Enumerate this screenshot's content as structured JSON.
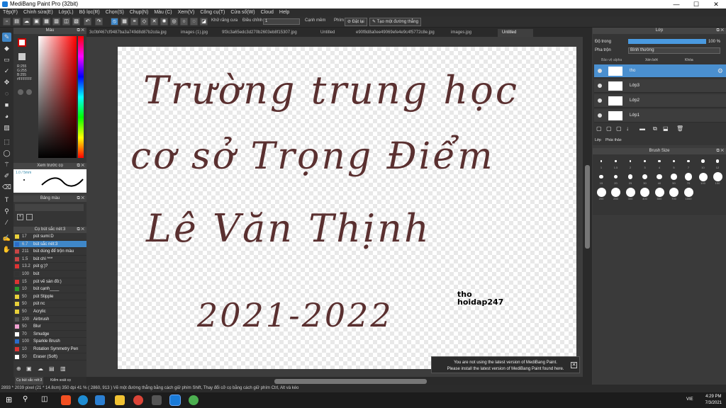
{
  "window": {
    "title": "MediBang Paint Pro (32bit)",
    "min": "—",
    "max": "☐",
    "close": "✕"
  },
  "menu": [
    "Tệp(F)",
    "Chỉnh sửa(E)",
    "Lớp(L)",
    "Bộ lọc(R)",
    "Chọn(S)",
    "Chụp(N)",
    "Màu (C)",
    "Xem(V)",
    "Công cụ(T)",
    "Cửa sổ(W)",
    "Cloud",
    "Help"
  ],
  "toolbar": {
    "antialias_label": "Khử răng cưa",
    "correction_label": "Điều chỉnh",
    "correction_value": "1",
    "canh_mem": "Cạnh mềm",
    "phim": "Phím",
    "dat_lai": "Đặt lại",
    "tao_duong": "Tạo một đường thẳng"
  },
  "color_panel": {
    "title": "Màu",
    "rgb": [
      "R:255",
      "G:255",
      "B:255"
    ],
    "hex": "#FFFFFF"
  },
  "nav_panel": {
    "title": "Xem trước cọ",
    "size": "1.0 / 5mm"
  },
  "color_set_panel": {
    "title": "Bảng màu"
  },
  "brush_panel": {
    "title": "Cọ bút sắc nét:3",
    "footer_tab1": "Cọ bút sắc nét:3",
    "footer_tab2": "Kiểm soát cọ",
    "brushes": [
      {
        "size": "17",
        "name": "pút sumi:D",
        "color": "#e8d03a"
      },
      {
        "size": "6.7",
        "name": "bút sắc nét:3",
        "color": "#2a6cc9",
        "selected": true
      },
      {
        "size": "211",
        "name": "bút dùng để trộn màu",
        "color": "#c94545"
      },
      {
        "size": "1.5",
        "name": "bút chì *^*",
        "color": "#c94545"
      },
      {
        "size": "13.2",
        "name": "pút g:)?",
        "color": "#d33"
      },
      {
        "size": "100",
        "name": "bút",
        "color": "#333"
      },
      {
        "size": "15",
        "name": "pút vẽ sàn đồ:)",
        "color": "#d33"
      },
      {
        "size": "10",
        "name": "bút cạnh____",
        "color": "#2a9a2a"
      },
      {
        "size": "50",
        "name": "pút Stipple",
        "color": "#e8d03a"
      },
      {
        "size": "50",
        "name": "pút nc",
        "color": "#e8d03a"
      },
      {
        "size": "50",
        "name": "Acrylic",
        "color": "#e8d03a"
      },
      {
        "size": "100",
        "name": "Airbrush",
        "color": "#555"
      },
      {
        "size": "50",
        "name": "Blur",
        "color": "#f0a0d0"
      },
      {
        "size": "70",
        "name": "Smudge",
        "color": "#ffffff"
      },
      {
        "size": "100",
        "name": "Sparkle Brush",
        "color": "#2a6cc9"
      },
      {
        "size": "10",
        "name": "Rotation Symmetry Pen",
        "color": "#d33"
      },
      {
        "size": "50",
        "name": "Eraser (Soft)",
        "color": "#ffffff"
      }
    ]
  },
  "tabs": [
    "3c0bf467cf9487ba3a749d8d87b2cda.jpg",
    "images (1).jpg",
    "9f3c3a65edc3d270b2603eb8f15307.jpg",
    "Untitled",
    "e90f8d8a0ee49069efe4e9c4f5772c8e.jpg",
    "images.jpg",
    "Untitled"
  ],
  "canvas": {
    "line1": "Trường trung học",
    "line2": "cơ sở Trọng Điểm",
    "line3": "Lê Văn Thịnh",
    "line4": "2021-2022",
    "wm1": "tho",
    "wm2": "hoidap247"
  },
  "notice": {
    "line1": "You are not using the latest version of MediBang Paint.",
    "line2": "Please install the latest version of MediBang Paint found here."
  },
  "layer_panel": {
    "title": "Lớp",
    "opacity_label": "Độ trong",
    "opacity_value": "100 %",
    "blend_label": "Pha trộn",
    "blend_value": "Bình thường",
    "protect": "Bảo vệ alpha",
    "clip": "Xén bớt",
    "lock": "Khóa",
    "layers": [
      {
        "name": "tho",
        "selected": true
      },
      {
        "name": "Lớp3"
      },
      {
        "name": "Lớp2"
      },
      {
        "name": "Lớp1"
      }
    ],
    "tab1": "Lớp",
    "tab2": "Phác thảo"
  },
  "brush_size_panel": {
    "title": "Brush Size",
    "sizes": [
      "1",
      "1.5",
      "2",
      "3",
      "4",
      "5",
      "7",
      "10",
      "12",
      "15",
      "20",
      "25",
      "30",
      "40",
      "50",
      "70",
      "100",
      "150",
      "200",
      "250",
      "300",
      "400",
      "500",
      "700",
      "1000"
    ]
  },
  "status": "2893 * 2039 pixel  (21 * 14.8cm)  350 dpi  41 %  ( 2860, 913 )  Vẽ một đường thẳng bằng cách giữ phím Shift, Thay đổi cỡ cọ bằng cách giữ phím Ctrl, Alt và kéo",
  "taskbar": {
    "time": "4:29 PM",
    "date": "7/3/2021",
    "lang": "VIE"
  }
}
